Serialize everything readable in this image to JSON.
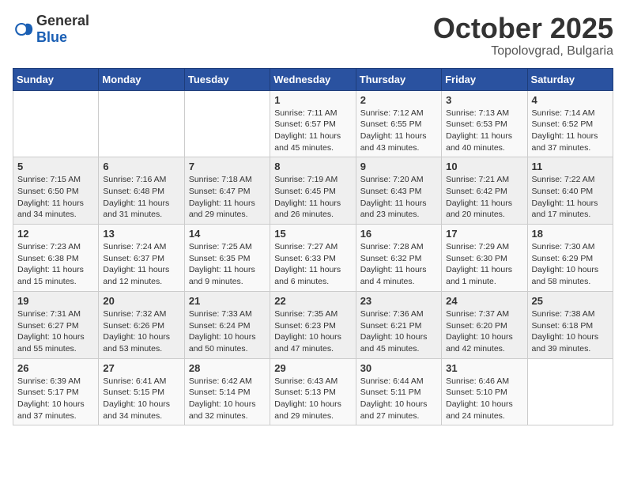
{
  "header": {
    "logo_general": "General",
    "logo_blue": "Blue",
    "month_year": "October 2025",
    "location": "Topolovgrad, Bulgaria"
  },
  "weekdays": [
    "Sunday",
    "Monday",
    "Tuesday",
    "Wednesday",
    "Thursday",
    "Friday",
    "Saturday"
  ],
  "weeks": [
    [
      {
        "day": "",
        "sunrise": "",
        "sunset": "",
        "daylight": ""
      },
      {
        "day": "",
        "sunrise": "",
        "sunset": "",
        "daylight": ""
      },
      {
        "day": "",
        "sunrise": "",
        "sunset": "",
        "daylight": ""
      },
      {
        "day": "1",
        "sunrise": "Sunrise: 7:11 AM",
        "sunset": "Sunset: 6:57 PM",
        "daylight": "Daylight: 11 hours and 45 minutes."
      },
      {
        "day": "2",
        "sunrise": "Sunrise: 7:12 AM",
        "sunset": "Sunset: 6:55 PM",
        "daylight": "Daylight: 11 hours and 43 minutes."
      },
      {
        "day": "3",
        "sunrise": "Sunrise: 7:13 AM",
        "sunset": "Sunset: 6:53 PM",
        "daylight": "Daylight: 11 hours and 40 minutes."
      },
      {
        "day": "4",
        "sunrise": "Sunrise: 7:14 AM",
        "sunset": "Sunset: 6:52 PM",
        "daylight": "Daylight: 11 hours and 37 minutes."
      }
    ],
    [
      {
        "day": "5",
        "sunrise": "Sunrise: 7:15 AM",
        "sunset": "Sunset: 6:50 PM",
        "daylight": "Daylight: 11 hours and 34 minutes."
      },
      {
        "day": "6",
        "sunrise": "Sunrise: 7:16 AM",
        "sunset": "Sunset: 6:48 PM",
        "daylight": "Daylight: 11 hours and 31 minutes."
      },
      {
        "day": "7",
        "sunrise": "Sunrise: 7:18 AM",
        "sunset": "Sunset: 6:47 PM",
        "daylight": "Daylight: 11 hours and 29 minutes."
      },
      {
        "day": "8",
        "sunrise": "Sunrise: 7:19 AM",
        "sunset": "Sunset: 6:45 PM",
        "daylight": "Daylight: 11 hours and 26 minutes."
      },
      {
        "day": "9",
        "sunrise": "Sunrise: 7:20 AM",
        "sunset": "Sunset: 6:43 PM",
        "daylight": "Daylight: 11 hours and 23 minutes."
      },
      {
        "day": "10",
        "sunrise": "Sunrise: 7:21 AM",
        "sunset": "Sunset: 6:42 PM",
        "daylight": "Daylight: 11 hours and 20 minutes."
      },
      {
        "day": "11",
        "sunrise": "Sunrise: 7:22 AM",
        "sunset": "Sunset: 6:40 PM",
        "daylight": "Daylight: 11 hours and 17 minutes."
      }
    ],
    [
      {
        "day": "12",
        "sunrise": "Sunrise: 7:23 AM",
        "sunset": "Sunset: 6:38 PM",
        "daylight": "Daylight: 11 hours and 15 minutes."
      },
      {
        "day": "13",
        "sunrise": "Sunrise: 7:24 AM",
        "sunset": "Sunset: 6:37 PM",
        "daylight": "Daylight: 11 hours and 12 minutes."
      },
      {
        "day": "14",
        "sunrise": "Sunrise: 7:25 AM",
        "sunset": "Sunset: 6:35 PM",
        "daylight": "Daylight: 11 hours and 9 minutes."
      },
      {
        "day": "15",
        "sunrise": "Sunrise: 7:27 AM",
        "sunset": "Sunset: 6:33 PM",
        "daylight": "Daylight: 11 hours and 6 minutes."
      },
      {
        "day": "16",
        "sunrise": "Sunrise: 7:28 AM",
        "sunset": "Sunset: 6:32 PM",
        "daylight": "Daylight: 11 hours and 4 minutes."
      },
      {
        "day": "17",
        "sunrise": "Sunrise: 7:29 AM",
        "sunset": "Sunset: 6:30 PM",
        "daylight": "Daylight: 11 hours and 1 minute."
      },
      {
        "day": "18",
        "sunrise": "Sunrise: 7:30 AM",
        "sunset": "Sunset: 6:29 PM",
        "daylight": "Daylight: 10 hours and 58 minutes."
      }
    ],
    [
      {
        "day": "19",
        "sunrise": "Sunrise: 7:31 AM",
        "sunset": "Sunset: 6:27 PM",
        "daylight": "Daylight: 10 hours and 55 minutes."
      },
      {
        "day": "20",
        "sunrise": "Sunrise: 7:32 AM",
        "sunset": "Sunset: 6:26 PM",
        "daylight": "Daylight: 10 hours and 53 minutes."
      },
      {
        "day": "21",
        "sunrise": "Sunrise: 7:33 AM",
        "sunset": "Sunset: 6:24 PM",
        "daylight": "Daylight: 10 hours and 50 minutes."
      },
      {
        "day": "22",
        "sunrise": "Sunrise: 7:35 AM",
        "sunset": "Sunset: 6:23 PM",
        "daylight": "Daylight: 10 hours and 47 minutes."
      },
      {
        "day": "23",
        "sunrise": "Sunrise: 7:36 AM",
        "sunset": "Sunset: 6:21 PM",
        "daylight": "Daylight: 10 hours and 45 minutes."
      },
      {
        "day": "24",
        "sunrise": "Sunrise: 7:37 AM",
        "sunset": "Sunset: 6:20 PM",
        "daylight": "Daylight: 10 hours and 42 minutes."
      },
      {
        "day": "25",
        "sunrise": "Sunrise: 7:38 AM",
        "sunset": "Sunset: 6:18 PM",
        "daylight": "Daylight: 10 hours and 39 minutes."
      }
    ],
    [
      {
        "day": "26",
        "sunrise": "Sunrise: 6:39 AM",
        "sunset": "Sunset: 5:17 PM",
        "daylight": "Daylight: 10 hours and 37 minutes."
      },
      {
        "day": "27",
        "sunrise": "Sunrise: 6:41 AM",
        "sunset": "Sunset: 5:15 PM",
        "daylight": "Daylight: 10 hours and 34 minutes."
      },
      {
        "day": "28",
        "sunrise": "Sunrise: 6:42 AM",
        "sunset": "Sunset: 5:14 PM",
        "daylight": "Daylight: 10 hours and 32 minutes."
      },
      {
        "day": "29",
        "sunrise": "Sunrise: 6:43 AM",
        "sunset": "Sunset: 5:13 PM",
        "daylight": "Daylight: 10 hours and 29 minutes."
      },
      {
        "day": "30",
        "sunrise": "Sunrise: 6:44 AM",
        "sunset": "Sunset: 5:11 PM",
        "daylight": "Daylight: 10 hours and 27 minutes."
      },
      {
        "day": "31",
        "sunrise": "Sunrise: 6:46 AM",
        "sunset": "Sunset: 5:10 PM",
        "daylight": "Daylight: 10 hours and 24 minutes."
      },
      {
        "day": "",
        "sunrise": "",
        "sunset": "",
        "daylight": ""
      }
    ]
  ]
}
